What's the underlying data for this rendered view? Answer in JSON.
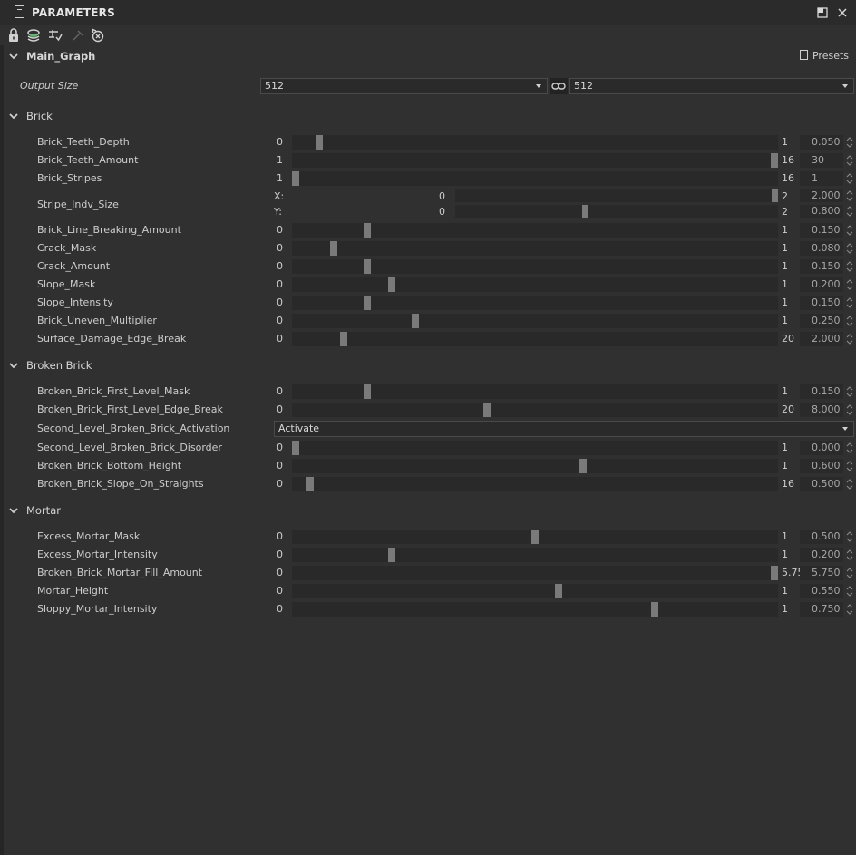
{
  "panel": {
    "title": "PARAMETERS"
  },
  "toolbar": {
    "icons": [
      "lock-icon",
      "layers-icon",
      "pin-list-icon",
      "pin-icon",
      "reset-icon"
    ]
  },
  "graph": {
    "name": "Main_Graph",
    "presets_label": "Presets",
    "output_size_label": "Output Size",
    "output_size_x": "512",
    "output_size_y": "512"
  },
  "sections": {
    "brick": "Brick",
    "broken": "Broken Brick",
    "mortar": "Mortar"
  },
  "brick_params": [
    {
      "name": "Brick_Teeth_Depth",
      "min": "0",
      "max": "1",
      "value": "0.050",
      "fraction": 0.05
    },
    {
      "name": "Brick_Teeth_Amount",
      "min": "1",
      "max": "16",
      "value": "30",
      "fraction": 1.0
    },
    {
      "name": "Brick_Stripes",
      "min": "1",
      "max": "16",
      "value": "1",
      "fraction": 0.0
    }
  ],
  "stripe_indv": {
    "name": "Stripe_Indv_Size",
    "x_label": "X:",
    "y_label": "Y:",
    "x": {
      "min": "0",
      "max": "2",
      "value": "2.000",
      "fraction": 1.0
    },
    "y": {
      "min": "0",
      "max": "2",
      "value": "0.800",
      "fraction": 0.4
    }
  },
  "brick_params2": [
    {
      "name": "Brick_Line_Breaking_Amount",
      "min": "0",
      "max": "1",
      "value": "0.150",
      "fraction": 0.15
    },
    {
      "name": "Crack_Mask",
      "min": "0",
      "max": "1",
      "value": "0.080",
      "fraction": 0.08
    },
    {
      "name": "Crack_Amount",
      "min": "0",
      "max": "1",
      "value": "0.150",
      "fraction": 0.15
    },
    {
      "name": "Slope_Mask",
      "min": "0",
      "max": "1",
      "value": "0.200",
      "fraction": 0.2
    },
    {
      "name": "Slope_Intensity",
      "min": "0",
      "max": "1",
      "value": "0.150",
      "fraction": 0.15
    },
    {
      "name": "Brick_Uneven_Multiplier",
      "min": "0",
      "max": "1",
      "value": "0.250",
      "fraction": 0.25
    },
    {
      "name": "Surface_Damage_Edge_Break",
      "min": "0",
      "max": "20",
      "value": "2.000",
      "fraction": 0.1
    }
  ],
  "broken_params": [
    {
      "name": "Broken_Brick_First_Level_Mask",
      "min": "0",
      "max": "1",
      "value": "0.150",
      "fraction": 0.15
    },
    {
      "name": "Broken_Brick_First_Level_Edge_Break",
      "min": "0",
      "max": "20",
      "value": "8.000",
      "fraction": 0.4
    }
  ],
  "activation": {
    "name": "Second_Level_Broken_Brick_Activation",
    "value": "Activate"
  },
  "broken_params2": [
    {
      "name": "Second_Level_Broken_Brick_Disorder",
      "min": "0",
      "max": "1",
      "value": "0.000",
      "fraction": 0.0
    },
    {
      "name": "Broken_Brick_Bottom_Height",
      "min": "0",
      "max": "1",
      "value": "0.600",
      "fraction": 0.6
    },
    {
      "name": "Broken_Brick_Slope_On_Straights",
      "min": "0",
      "max": "16",
      "value": "0.500",
      "fraction": 0.031
    }
  ],
  "mortar_params": [
    {
      "name": "Excess_Mortar_Mask",
      "min": "0",
      "max": "1",
      "value": "0.500",
      "fraction": 0.5
    },
    {
      "name": "Excess_Mortar_Intensity",
      "min": "0",
      "max": "1",
      "value": "0.200",
      "fraction": 0.2
    },
    {
      "name": "Broken_Brick_Mortar_Fill_Amount",
      "min": "0",
      "max": "5.75",
      "value": "5.750",
      "fraction": 1.0
    },
    {
      "name": "Mortar_Height",
      "min": "0",
      "max": "1",
      "value": "0.550",
      "fraction": 0.55
    },
    {
      "name": "Sloppy_Mortar_Intensity",
      "min": "0",
      "max": "1",
      "value": "0.750",
      "fraction": 0.75
    }
  ]
}
